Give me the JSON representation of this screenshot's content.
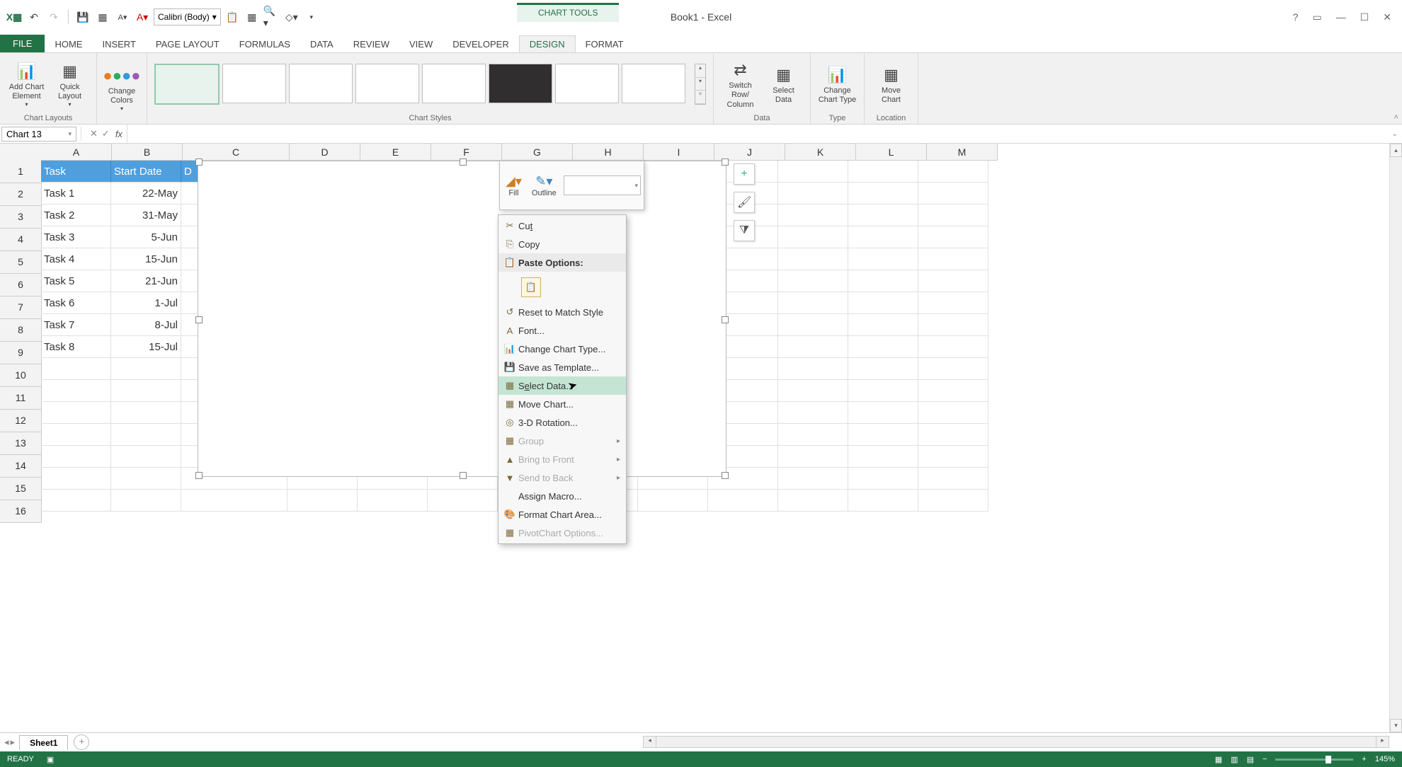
{
  "window": {
    "title": "Book1 - Excel",
    "chart_tools": "CHART TOOLS"
  },
  "qat_font": "Calibri (Body)",
  "tabs": {
    "file": "FILE",
    "home": "HOME",
    "insert": "INSERT",
    "page_layout": "PAGE LAYOUT",
    "formulas": "FORMULAS",
    "data": "DATA",
    "review": "REVIEW",
    "view": "VIEW",
    "developer": "DEVELOPER",
    "design": "DESIGN",
    "format": "FORMAT"
  },
  "ribbon": {
    "add_chart_element": "Add Chart Element",
    "quick_layout": "Quick Layout",
    "change_colors": "Change Colors",
    "switch_row_col": "Switch Row/ Column",
    "select_data": "Select Data",
    "change_chart_type": "Change Chart Type",
    "move_chart": "Move Chart",
    "groups": {
      "chart_layouts": "Chart Layouts",
      "chart_styles": "Chart Styles",
      "data": "Data",
      "type": "Type",
      "location": "Location"
    }
  },
  "name_box": "Chart 13",
  "columns": [
    "A",
    "B",
    "C",
    "D",
    "E",
    "F",
    "G",
    "H",
    "I",
    "J",
    "K",
    "L",
    "M"
  ],
  "rows": [
    "1",
    "2",
    "3",
    "4",
    "5",
    "6",
    "7",
    "8",
    "9",
    "10",
    "11",
    "12",
    "13",
    "14",
    "15",
    "16"
  ],
  "headers": {
    "a": "Task",
    "b": "Start Date",
    "c": "D"
  },
  "data_rows": [
    {
      "task": "Task 1",
      "date": "22-May"
    },
    {
      "task": "Task 2",
      "date": "31-May"
    },
    {
      "task": "Task 3",
      "date": "5-Jun"
    },
    {
      "task": "Task 4",
      "date": "15-Jun"
    },
    {
      "task": "Task 5",
      "date": "21-Jun"
    },
    {
      "task": "Task 6",
      "date": "1-Jul"
    },
    {
      "task": "Task 7",
      "date": "8-Jul"
    },
    {
      "task": "Task 8",
      "date": "15-Jul"
    }
  ],
  "mini_toolbar": {
    "fill": "Fill",
    "outline": "Outline"
  },
  "ctx": {
    "cut": "Cut",
    "copy": "Copy",
    "paste_options": "Paste Options:",
    "reset_style": "Reset to Match Style",
    "font": "Font...",
    "change_chart_type": "Change Chart Type...",
    "save_template": "Save as Template...",
    "select_data": "Select Data...",
    "move_chart": "Move Chart...",
    "rotation_3d": "3-D Rotation...",
    "group": "Group",
    "bring_front": "Bring to Front",
    "send_back": "Send to Back",
    "assign_macro": "Assign Macro...",
    "format_chart_area": "Format Chart Area...",
    "pivotchart_options": "PivotChart Options..."
  },
  "sheet": {
    "name": "Sheet1"
  },
  "status": {
    "ready": "READY",
    "zoom": "145%"
  }
}
